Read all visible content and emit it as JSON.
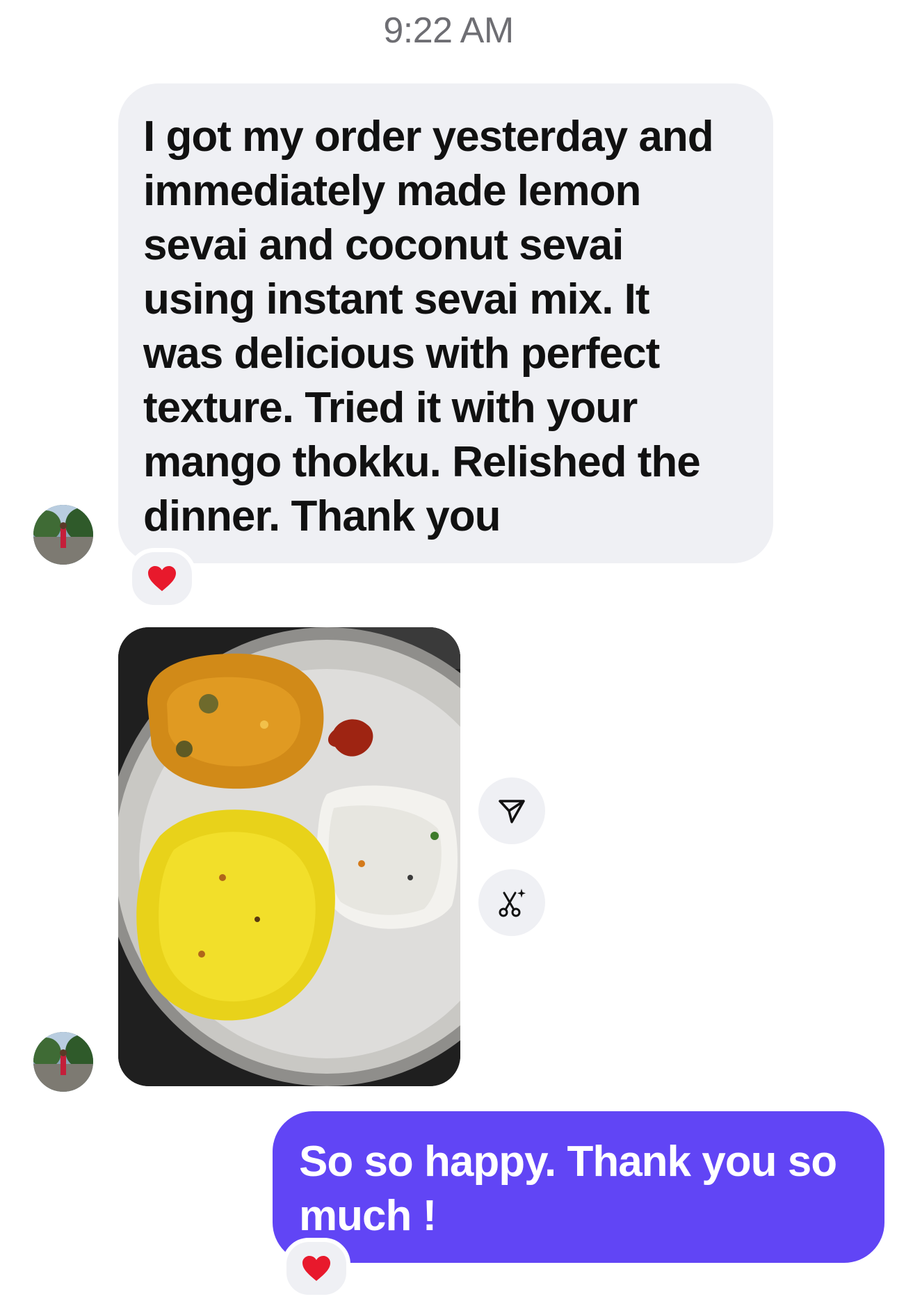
{
  "conversation": {
    "timestamp": "9:22 AM",
    "incoming_message": {
      "lines": [
        "I got my order yesterday and",
        "immediately made lemon",
        "sevai and coconut sevai",
        "using instant sevai mix. It",
        "was delicious with perfect",
        "texture. Tried it with your",
        "mango thokku. Relished the",
        "dinner. Thank you"
      ],
      "reaction": "❤️"
    },
    "outgoing_message": {
      "lines": [
        "So so happy. Thank you so",
        "much !"
      ],
      "reaction": "❤️"
    },
    "photo_actions": {
      "share_icon": "send-icon",
      "remix_icon": "scissors-sparkle-icon"
    }
  },
  "colors": {
    "incoming_bubble": "#eff0f4",
    "outgoing_bubble": "#6145f5",
    "timestamp_text": "#6e6e73"
  }
}
